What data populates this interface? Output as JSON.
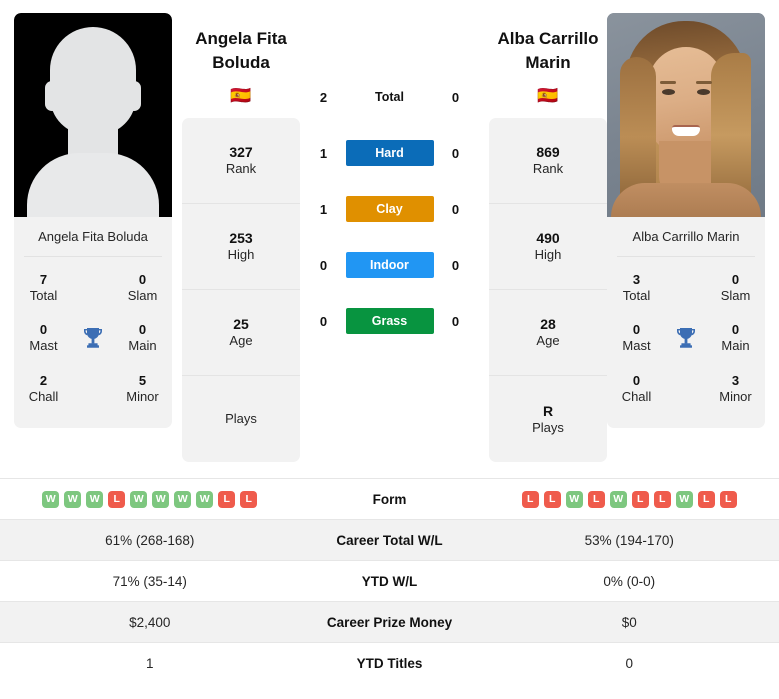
{
  "players": {
    "left": {
      "name_heading": "Angela Fita Boluda",
      "caption": "Angela Fita Boluda",
      "flag": "🇪🇸",
      "photo_type": "placeholder-silhouette",
      "titles": [
        {
          "value": "7",
          "label": "Total"
        },
        {
          "value": "0",
          "label": "Slam"
        },
        {
          "value": "0",
          "label": "Mast"
        },
        {
          "value": "0",
          "label": "Main"
        },
        {
          "value": "2",
          "label": "Chall"
        },
        {
          "value": "5",
          "label": "Minor"
        }
      ],
      "stats": [
        {
          "value": "327",
          "label": "Rank"
        },
        {
          "value": "253",
          "label": "High"
        },
        {
          "value": "25",
          "label": "Age"
        },
        {
          "value": "",
          "label": "Plays"
        }
      ]
    },
    "right": {
      "name_heading": "Alba Carrillo Marin",
      "caption": "Alba Carrillo Marin",
      "flag": "🇪🇸",
      "photo_type": "portrait",
      "titles": [
        {
          "value": "3",
          "label": "Total"
        },
        {
          "value": "0",
          "label": "Slam"
        },
        {
          "value": "0",
          "label": "Mast"
        },
        {
          "value": "0",
          "label": "Main"
        },
        {
          "value": "0",
          "label": "Chall"
        },
        {
          "value": "3",
          "label": "Minor"
        }
      ],
      "stats": [
        {
          "value": "869",
          "label": "Rank"
        },
        {
          "value": "490",
          "label": "High"
        },
        {
          "value": "28",
          "label": "Age"
        },
        {
          "value": "R",
          "label": "Plays"
        }
      ]
    }
  },
  "head_to_head": [
    {
      "left": "2",
      "label": "Total",
      "right": "0",
      "style": "plain",
      "color": ""
    },
    {
      "left": "1",
      "label": "Hard",
      "right": "0",
      "style": "badge",
      "color": "#0b6cb8"
    },
    {
      "left": "1",
      "label": "Clay",
      "right": "0",
      "style": "badge",
      "color": "#e09000"
    },
    {
      "left": "0",
      "label": "Indoor",
      "right": "0",
      "style": "badge",
      "color": "#2196f3"
    },
    {
      "left": "0",
      "label": "Grass",
      "right": "0",
      "style": "badge",
      "color": "#089440"
    }
  ],
  "comparison_rows": [
    {
      "label": "Form",
      "type": "form",
      "left_form": [
        "W",
        "W",
        "W",
        "L",
        "W",
        "W",
        "W",
        "W",
        "L",
        "L"
      ],
      "right_form": [
        "L",
        "L",
        "W",
        "L",
        "W",
        "L",
        "L",
        "W",
        "L",
        "L"
      ],
      "shaded": false
    },
    {
      "label": "Career Total W/L",
      "type": "text",
      "left": "61% (268-168)",
      "right": "53% (194-170)",
      "shaded": true
    },
    {
      "label": "YTD W/L",
      "type": "text",
      "left": "71% (35-14)",
      "right": "0% (0-0)",
      "shaded": false
    },
    {
      "label": "Career Prize Money",
      "type": "text",
      "left": "$2,400",
      "right": "$0",
      "shaded": true
    },
    {
      "label": "YTD Titles",
      "type": "text",
      "left": "1",
      "right": "0",
      "shaded": false
    }
  ],
  "colors": {
    "win": "#7dc77f",
    "loss": "#ef5b4c",
    "trophy": "#3c6eb4",
    "panel": "#f2f2f2"
  }
}
